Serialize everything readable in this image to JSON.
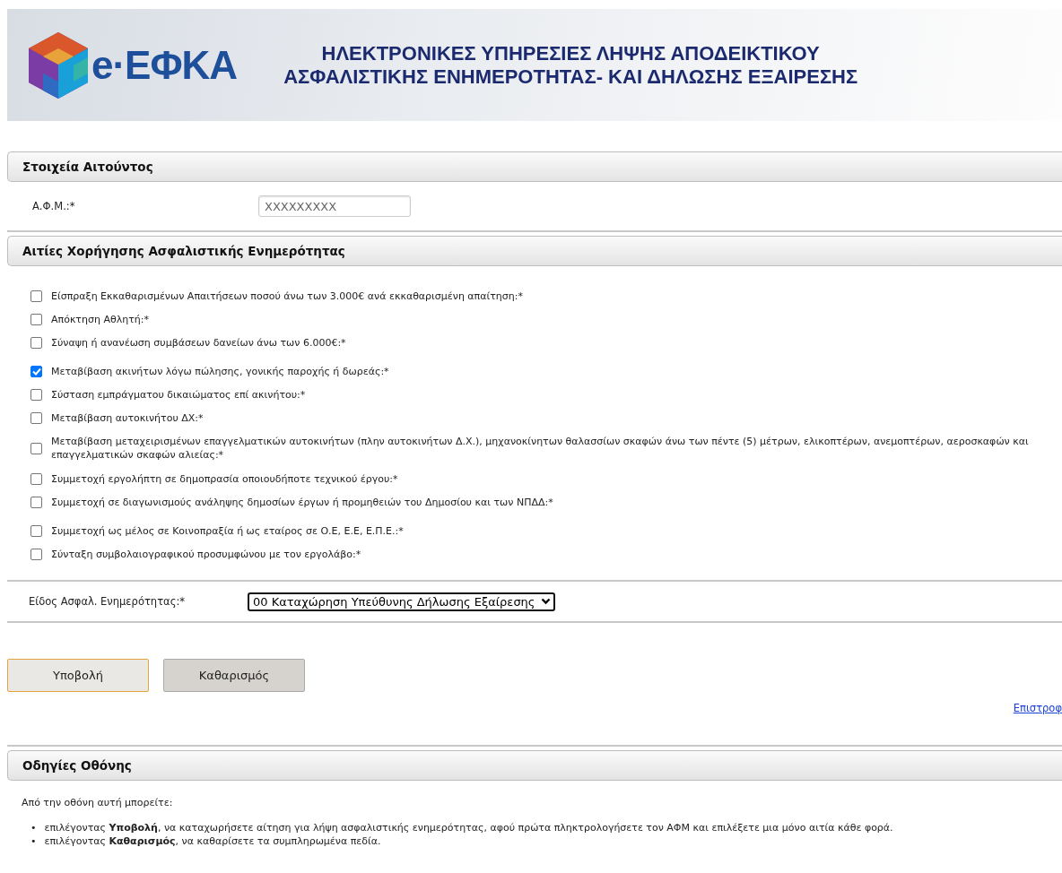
{
  "header": {
    "logo_text": "e·ΕΦΚΑ",
    "title_lines": [
      "ΗΛΕΚΤΡΟΝΙΚΕΣ ΥΠΗΡΕΣΙΕΣ ΛΗΨΗΣ ΑΠΟΔΕΙΚΤΙΚΟΥ",
      "ΑΣΦΑΛΙΣΤΙΚΗΣ ΕΝΗΜΕΡΟΤΗΤΑΣ- ΚΑΙ ΔΗΛΩΣΗΣ ΕΞΑΙΡΕΣΗΣ"
    ]
  },
  "applicant": {
    "title": "Στοιχεία Αιτούντος",
    "afm_label": "Α.Φ.Μ.:*",
    "afm_placeholder": "XXXXXXXXX"
  },
  "reasons": {
    "title": "Αιτίες Χορήγησης Ασφαλιστικής Ενημερότητας",
    "items": [
      {
        "label": "Είσπραξη Εκκαθαρισμένων Απαιτήσεων ποσού άνω των 3.000€ ανά εκκαθαρισμένη απαίτηση:*",
        "checked": false
      },
      {
        "label": "Απόκτηση Αθλητή:*",
        "checked": false
      },
      {
        "label": "Σύναψη ή ανανέωση συμβάσεων δανείων άνω των 6.000€:*",
        "checked": false
      },
      {
        "label": "Μεταβίβαση ακινήτων λόγω πώλησης, γονικής παροχής ή δωρεάς:*",
        "checked": true
      },
      {
        "label": "Σύσταση εμπράγματου δικαιώματος επί ακινήτου:*",
        "checked": false
      },
      {
        "label": "Μεταβίβαση αυτοκινήτου ΔΧ:*",
        "checked": false
      },
      {
        "label": "Μεταβίβαση μεταχειρισμένων επαγγελματικών αυτοκινήτων (πλην αυτοκινήτων Δ.Χ.), μηχανοκίνητων θαλασσίων σκαφών άνω των πέντε (5) μέτρων, ελικοπτέρων, ανεμοπτέρων, αεροσκαφών και επαγγελματικών σκαφών αλιείας:*",
        "checked": false
      },
      {
        "label": "Συμμετοχή εργολήπτη σε δημοπρασία οποιουδήποτε τεχνικού έργου:*",
        "checked": false
      },
      {
        "label": "Συμμετοχή σε διαγωνισμούς ανάληψης δημοσίων έργων ή προμηθειών του Δημοσίου και των ΝΠΔΔ:*",
        "checked": false
      },
      {
        "label": "Συμμετοχή ως μέλος σε Κοινοπραξία ή ως εταίρος σε Ο.Ε, Ε.Ε, Ε.Π.Ε.:*",
        "checked": false
      },
      {
        "label": "Σύνταξη συμβολαιογραφικού προσυμφώνου με τον εργολάβο:*",
        "checked": false
      }
    ]
  },
  "type_field": {
    "label": "Είδος Ασφαλ. Ενημερότητας:*",
    "value": "00 Καταχώρηση Υπεύθυνης Δήλωσης Εξαίρεσης"
  },
  "buttons": [
    {
      "label": "Υποβολή",
      "focused": true
    },
    {
      "label": "Καθαρισμός",
      "focused": false
    }
  ],
  "back_link": "Επιστροφ",
  "instructions": {
    "title": "Οδηγίες Οθόνης",
    "intro": "Από την οθόνη αυτή μπορείτε:",
    "bullets": [
      {
        "marker": "•",
        "text": "επιλέγοντας **Υποβολή**, να καταχωρήσετε αίτηση για λήψη ασφαλιστικής ενημερότητας, αφού πρώτα πληκτρολογήσετε τον ΑΦΜ και επιλέξετε μια μόνο αιτία κάθε φορά."
      },
      {
        "marker": "•",
        "text": "επιλέγοντας **Καθαρισμός**, να καθαρίσετε τα συμπληρωμένα πεδία."
      }
    ]
  }
}
